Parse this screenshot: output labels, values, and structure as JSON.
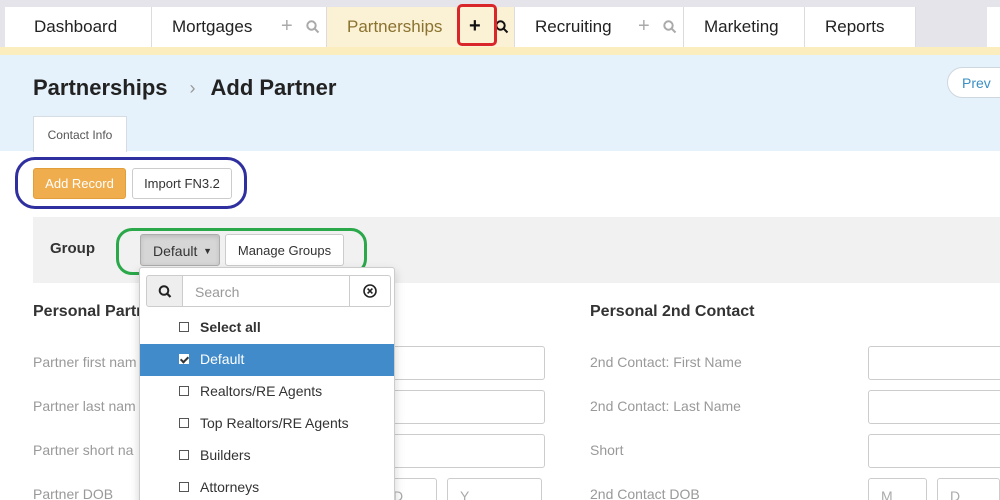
{
  "tabs": [
    {
      "label": "Dashboard"
    },
    {
      "label": "Mortgages"
    },
    {
      "label": "Partnerships"
    },
    {
      "label": "Recruiting"
    },
    {
      "label": "Marketing"
    },
    {
      "label": "Reports"
    }
  ],
  "tab_icons": {
    "plus": "+",
    "search": "search-icon"
  },
  "breadcrumb": {
    "parent": "Partnerships",
    "separator": "›",
    "current": "Add Partner"
  },
  "prev_label": "Prev",
  "subtab_label": "Contact Info",
  "actions": {
    "add_record": "Add Record",
    "import": "Import FN3.2"
  },
  "group": {
    "label": "Group",
    "selected": "Default",
    "manage": "Manage Groups"
  },
  "dropdown": {
    "search_placeholder": "Search",
    "items": [
      {
        "label": "Select all",
        "checked": false
      },
      {
        "label": "Default",
        "checked": true
      },
      {
        "label": "Realtors/RE Agents",
        "checked": false
      },
      {
        "label": "Top Realtors/RE Agents",
        "checked": false
      },
      {
        "label": "Builders",
        "checked": false
      },
      {
        "label": "Attorneys",
        "checked": false
      }
    ]
  },
  "form": {
    "left_section": "Personal Partn",
    "right_section": "Personal 2nd Contact",
    "left_labels": [
      "Partner first nam",
      "Partner last nam",
      "Partner short na",
      "Partner DOB"
    ],
    "right_labels": [
      "2nd Contact: First Name",
      "2nd Contact: Last Name",
      "Short",
      "2nd Contact DOB"
    ],
    "dob_placeholders": {
      "day": "D",
      "year": "Y",
      "month": "M"
    }
  },
  "colors": {
    "active_tab_bg": "#fbf1d4",
    "header_bg": "#e5f2fb",
    "add_record_bg": "#f0ad4e",
    "selected_item_bg": "#428bca",
    "annotation_red": "#d9262b",
    "annotation_blue": "#2f2f9f",
    "annotation_green": "#2aa84a"
  }
}
